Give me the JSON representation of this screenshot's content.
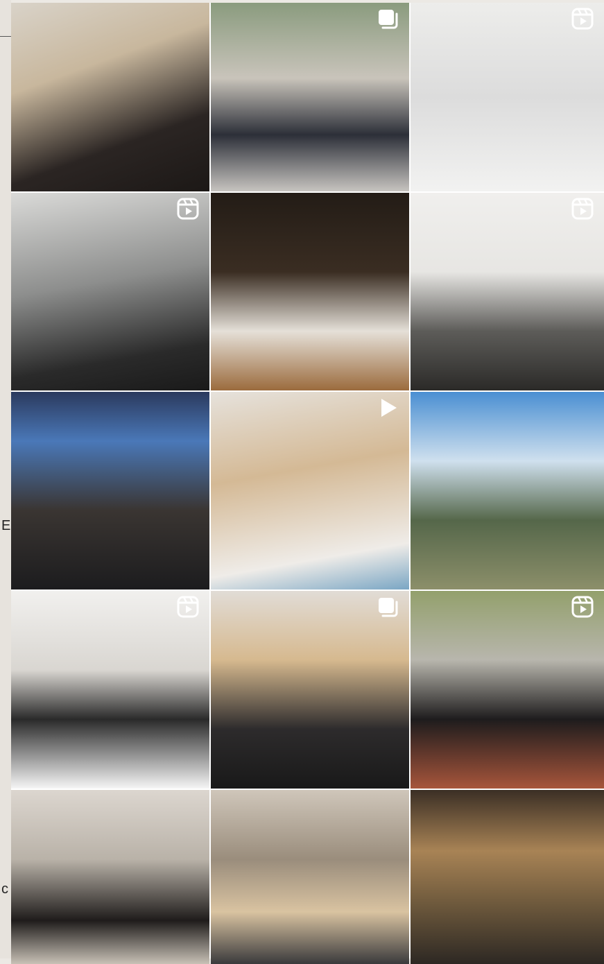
{
  "page_edge": {
    "fragment_1": "E",
    "fragment_2": "c"
  },
  "grid": {
    "posts": [
      {
        "type": "photo"
      },
      {
        "type": "carousel",
        "icon": "carousel-icon"
      },
      {
        "type": "reel",
        "icon": "reel-icon"
      },
      {
        "type": "reel",
        "icon": "reel-icon"
      },
      {
        "type": "photo"
      },
      {
        "type": "reel",
        "icon": "reel-icon"
      },
      {
        "type": "photo"
      },
      {
        "type": "video",
        "icon": "play-icon"
      },
      {
        "type": "photo"
      },
      {
        "type": "reel",
        "icon": "reel-icon"
      },
      {
        "type": "carousel",
        "icon": "carousel-icon"
      },
      {
        "type": "reel",
        "icon": "reel-icon"
      },
      {
        "type": "photo"
      },
      {
        "type": "photo"
      },
      {
        "type": "photo"
      }
    ]
  }
}
